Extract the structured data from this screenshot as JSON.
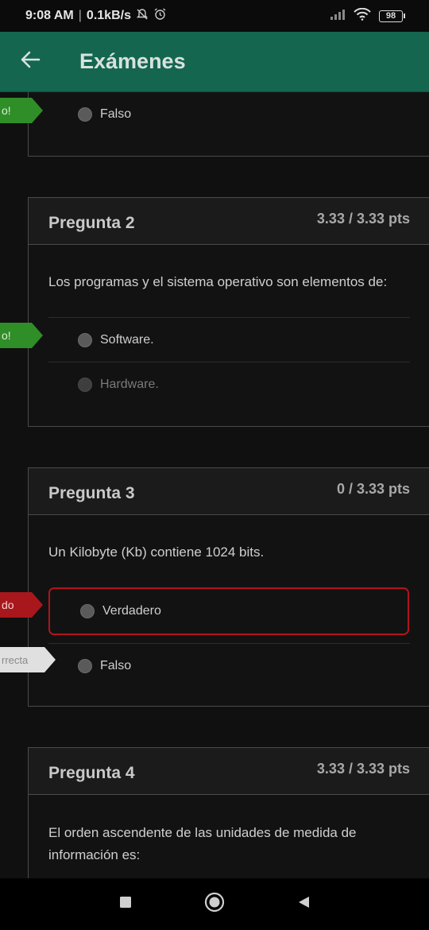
{
  "status": {
    "time": "9:08 AM",
    "separator": "|",
    "speed": "0.1kB/s",
    "battery": "98"
  },
  "app_bar": {
    "title": "Exámenes"
  },
  "flags": {
    "correct": "o!",
    "wrong": "do",
    "correct_answer": "rrecta"
  },
  "questions": [
    {
      "answers": [
        {
          "label": "Falso"
        }
      ]
    },
    {
      "title": "Pregunta 2",
      "points": "3.33 / 3.33 pts",
      "text": "Los programas y el sistema operativo son elementos de:",
      "answers": [
        {
          "label": "Software."
        },
        {
          "label": "Hardware."
        }
      ]
    },
    {
      "title": "Pregunta 3",
      "points": "0 / 3.33 pts",
      "text": "Un Kilobyte (Kb) contiene 1024 bits.",
      "answers": [
        {
          "label": "Verdadero"
        },
        {
          "label": "Falso"
        }
      ]
    },
    {
      "title": "Pregunta 4",
      "points": "3.33 / 3.33 pts",
      "text": "El orden ascendente de las unidades de medida de información es:"
    }
  ],
  "colors": {
    "app_bar": "#14664f",
    "correct_flag": "#2f8e27",
    "wrong_flag": "#a8171c",
    "wrong_border": "#b0141b"
  }
}
